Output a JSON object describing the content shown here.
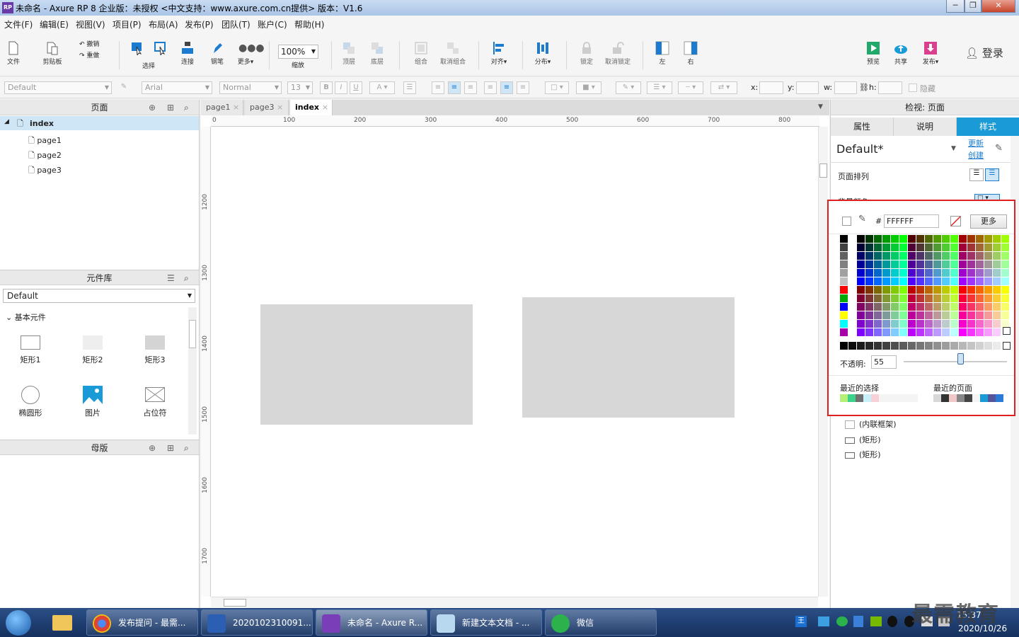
{
  "titlebar": {
    "title": "未命名 - Axure RP 8 企业版：未授权    <中文支持：www.axure.com.cn提供> 版本：V1.6",
    "icon_text": "RP"
  },
  "menu": [
    "文件(F)",
    "编辑(E)",
    "视图(V)",
    "项目(P)",
    "布局(A)",
    "发布(P)",
    "团队(T)",
    "账户(C)",
    "帮助(H)"
  ],
  "toolbar": {
    "file": "文件",
    "clipboard": "剪贴板",
    "undo": "撤销",
    "redo": "重做",
    "select": "选择",
    "connect": "连接",
    "pen": "钢笔",
    "more": "更多▾",
    "zoom_value": "100%",
    "zoom_label": "缩放",
    "top": "顶层",
    "bottom": "底层",
    "group": "组合",
    "ungroup": "取消组合",
    "align": "对齐▾",
    "distribute": "分布▾",
    "lock": "锁定",
    "unlock": "取消锁定",
    "left": "左",
    "right": "右",
    "preview": "预览",
    "share": "共享",
    "publish": "发布▾",
    "login": "登录"
  },
  "format": {
    "style": "Default",
    "font": "Arial",
    "weight": "Normal",
    "size": "13",
    "x": "x:",
    "y": "y:",
    "w": "w:",
    "h": "h:",
    "hidden": "隐藏"
  },
  "pages": {
    "title": "页面",
    "root": "index",
    "children": [
      "page1",
      "page2",
      "page3"
    ]
  },
  "library": {
    "title": "元件库",
    "selected": "Default",
    "group": "基本元件",
    "widgets": [
      "矩形1",
      "矩形2",
      "矩形3",
      "椭圆形",
      "图片",
      "占位符"
    ]
  },
  "masters": {
    "title": "母版"
  },
  "tabs": [
    "page1",
    "page3",
    "index"
  ],
  "ruler_h": [
    "0",
    "100",
    "200",
    "300",
    "400",
    "500",
    "600",
    "700",
    "800"
  ],
  "ruler_v": [
    "1200",
    "1300",
    "1400",
    "1500",
    "1600",
    "1700"
  ],
  "inspector": {
    "title": "检视: 页面",
    "tabs": [
      "属性",
      "说明",
      "样式"
    ],
    "style_name": "Default*",
    "update": "更新",
    "create": "创建",
    "page_align": "页面排列",
    "bg_color": "背景颜色",
    "outline": [
      "(内联框架)",
      "(矩形)",
      "(矩形)"
    ]
  },
  "picker": {
    "hex_prefix": "#",
    "hex": "FFFFFF",
    "more": "更多",
    "opacity_label": "不透明:",
    "opacity_value": "55",
    "opacity": 0.55,
    "recent": "最近的选择",
    "recent_page": "最近的页面"
  },
  "taskbar": {
    "items": [
      "发布提问 - 最需...",
      "2020102310091...",
      "未命名 - Axure R...",
      "新建文本文档 - ...",
      "微信"
    ],
    "time": "15:37",
    "date": "2020/10/26",
    "watermark": "最需教育"
  },
  "colors": {
    "accent": "#1a9ad6",
    "picker_border": "#e02020",
    "shape_fill": "#d7d7d7"
  }
}
